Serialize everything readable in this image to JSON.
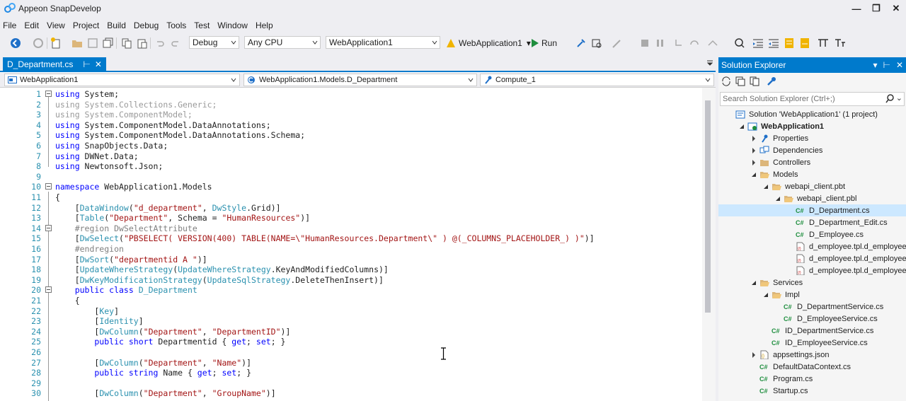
{
  "app": {
    "title": "Appeon SnapDevelop"
  },
  "menu": [
    "File",
    "Edit",
    "View",
    "Project",
    "Build",
    "Debug",
    "Tools",
    "Test",
    "Window",
    "Help"
  ],
  "toolbar": {
    "config": "Debug",
    "platform": "Any CPU",
    "project": "WebApplication1",
    "startup": "WebApplication1",
    "run": "Run"
  },
  "editor": {
    "tab": "D_Department.cs",
    "nav": {
      "project": "WebApplication1",
      "class": "WebApplication1.Models.D_Department",
      "member": "Compute_1"
    },
    "lines": [
      {
        "n": "1",
        "fold": true,
        "segs": [
          {
            "c": "k",
            "t": "using"
          },
          {
            "c": "",
            "t": " System;"
          }
        ]
      },
      {
        "n": "2",
        "segs": [
          {
            "c": "g",
            "t": "using System.Collections.Generic;"
          }
        ]
      },
      {
        "n": "3",
        "segs": [
          {
            "c": "g",
            "t": "using System.ComponentModel;"
          }
        ]
      },
      {
        "n": "4",
        "segs": [
          {
            "c": "k",
            "t": "using"
          },
          {
            "c": "",
            "t": " System.ComponentModel.DataAnnotations;"
          }
        ]
      },
      {
        "n": "5",
        "segs": [
          {
            "c": "k",
            "t": "using"
          },
          {
            "c": "",
            "t": " System.ComponentModel.DataAnnotations.Schema;"
          }
        ]
      },
      {
        "n": "6",
        "segs": [
          {
            "c": "k",
            "t": "using"
          },
          {
            "c": "",
            "t": " SnapObjects.Data;"
          }
        ]
      },
      {
        "n": "7",
        "segs": [
          {
            "c": "k",
            "t": "using"
          },
          {
            "c": "",
            "t": " DWNet.Data;"
          }
        ]
      },
      {
        "n": "8",
        "segs": [
          {
            "c": "k",
            "t": "using"
          },
          {
            "c": "",
            "t": " Newtonsoft.Json;"
          }
        ]
      },
      {
        "n": "9",
        "segs": []
      },
      {
        "n": "10",
        "fold": true,
        "segs": [
          {
            "c": "k",
            "t": "namespace"
          },
          {
            "c": "",
            "t": " WebApplication1.Models"
          }
        ]
      },
      {
        "n": "11",
        "segs": [
          {
            "c": "",
            "t": "{"
          }
        ]
      },
      {
        "n": "12",
        "segs": [
          {
            "c": "",
            "t": "    ["
          },
          {
            "c": "t",
            "t": "DataWindow"
          },
          {
            "c": "",
            "t": "("
          },
          {
            "c": "s",
            "t": "\"d_department\""
          },
          {
            "c": "",
            "t": ", "
          },
          {
            "c": "t",
            "t": "DwStyle"
          },
          {
            "c": "",
            "t": ".Grid)]"
          }
        ]
      },
      {
        "n": "13",
        "segs": [
          {
            "c": "",
            "t": "    ["
          },
          {
            "c": "t",
            "t": "Table"
          },
          {
            "c": "",
            "t": "("
          },
          {
            "c": "s",
            "t": "\"Department\""
          },
          {
            "c": "",
            "t": ", Schema = "
          },
          {
            "c": "s",
            "t": "\"HumanResources\""
          },
          {
            "c": "",
            "t": ")]"
          }
        ]
      },
      {
        "n": "14",
        "fold": true,
        "segs": [
          {
            "c": "r",
            "t": "    #region DwSelectAttribute"
          }
        ]
      },
      {
        "n": "15",
        "segs": [
          {
            "c": "",
            "t": "    ["
          },
          {
            "c": "t",
            "t": "DwSelect"
          },
          {
            "c": "",
            "t": "("
          },
          {
            "c": "s",
            "t": "\"PBSELECT( VERSION(400) TABLE(NAME=\\\"HumanResources.Department\\\" ) @(_COLUMNS_PLACEHOLDER_) )\""
          },
          {
            "c": "",
            "t": ")]"
          }
        ]
      },
      {
        "n": "16",
        "segs": [
          {
            "c": "r",
            "t": "    #endregion"
          }
        ]
      },
      {
        "n": "17",
        "segs": [
          {
            "c": "",
            "t": "    ["
          },
          {
            "c": "t",
            "t": "DwSort"
          },
          {
            "c": "",
            "t": "("
          },
          {
            "c": "s",
            "t": "\"departmentid A \""
          },
          {
            "c": "",
            "t": ")]"
          }
        ]
      },
      {
        "n": "18",
        "segs": [
          {
            "c": "",
            "t": "    ["
          },
          {
            "c": "t",
            "t": "UpdateWhereStrategy"
          },
          {
            "c": "",
            "t": "("
          },
          {
            "c": "t",
            "t": "UpdateWhereStrategy"
          },
          {
            "c": "",
            "t": ".KeyAndModifiedColumns)]"
          }
        ]
      },
      {
        "n": "19",
        "segs": [
          {
            "c": "",
            "t": "    ["
          },
          {
            "c": "t",
            "t": "DwKeyModificationStrategy"
          },
          {
            "c": "",
            "t": "("
          },
          {
            "c": "t",
            "t": "UpdateSqlStrategy"
          },
          {
            "c": "",
            "t": ".DeleteThenInsert)]"
          }
        ]
      },
      {
        "n": "20",
        "fold": true,
        "segs": [
          {
            "c": "k",
            "t": "    public class"
          },
          {
            "c": "",
            "t": " "
          },
          {
            "c": "t",
            "t": "D_Department"
          }
        ]
      },
      {
        "n": "21",
        "segs": [
          {
            "c": "",
            "t": "    {"
          }
        ]
      },
      {
        "n": "22",
        "segs": [
          {
            "c": "",
            "t": "        ["
          },
          {
            "c": "t",
            "t": "Key"
          },
          {
            "c": "",
            "t": "]"
          }
        ]
      },
      {
        "n": "23",
        "segs": [
          {
            "c": "",
            "t": "        ["
          },
          {
            "c": "t",
            "t": "Identity"
          },
          {
            "c": "",
            "t": "]"
          }
        ]
      },
      {
        "n": "24",
        "segs": [
          {
            "c": "",
            "t": "        ["
          },
          {
            "c": "t",
            "t": "DwColumn"
          },
          {
            "c": "",
            "t": "("
          },
          {
            "c": "s",
            "t": "\"Department\""
          },
          {
            "c": "",
            "t": ", "
          },
          {
            "c": "s",
            "t": "\"DepartmentID\""
          },
          {
            "c": "",
            "t": ")]"
          }
        ]
      },
      {
        "n": "25",
        "segs": [
          {
            "c": "k",
            "t": "        public short"
          },
          {
            "c": "",
            "t": " Departmentid { "
          },
          {
            "c": "k",
            "t": "get"
          },
          {
            "c": "",
            "t": "; "
          },
          {
            "c": "k",
            "t": "set"
          },
          {
            "c": "",
            "t": "; }"
          }
        ]
      },
      {
        "n": "26",
        "segs": []
      },
      {
        "n": "27",
        "segs": [
          {
            "c": "",
            "t": "        ["
          },
          {
            "c": "t",
            "t": "DwColumn"
          },
          {
            "c": "",
            "t": "("
          },
          {
            "c": "s",
            "t": "\"Department\""
          },
          {
            "c": "",
            "t": ", "
          },
          {
            "c": "s",
            "t": "\"Name\""
          },
          {
            "c": "",
            "t": ")]"
          }
        ]
      },
      {
        "n": "28",
        "segs": [
          {
            "c": "k",
            "t": "        public string"
          },
          {
            "c": "",
            "t": " Name { "
          },
          {
            "c": "k",
            "t": "get"
          },
          {
            "c": "",
            "t": "; "
          },
          {
            "c": "k",
            "t": "set"
          },
          {
            "c": "",
            "t": "; }"
          }
        ]
      },
      {
        "n": "29",
        "segs": []
      },
      {
        "n": "30",
        "segs": [
          {
            "c": "",
            "t": "        ["
          },
          {
            "c": "t",
            "t": "DwColumn"
          },
          {
            "c": "",
            "t": "("
          },
          {
            "c": "s",
            "t": "\"Department\""
          },
          {
            "c": "",
            "t": ", "
          },
          {
            "c": "s",
            "t": "\"GroupName\""
          },
          {
            "c": "",
            "t": ")]"
          }
        ]
      }
    ]
  },
  "solution_explorer": {
    "title": "Solution Explorer",
    "search_placeholder": "Search Solution Explorer (Ctrl+;)",
    "nodes": [
      {
        "label": "Solution 'WebApplication1' (1 project)",
        "level": 0,
        "icon": "solution-icon",
        "tw": "none"
      },
      {
        "label": "WebApplication1",
        "level": 1,
        "icon": "project-icon",
        "tw": "open",
        "bold": true
      },
      {
        "label": "Properties",
        "level": 2,
        "icon": "wrench-icon",
        "tw": "closed"
      },
      {
        "label": "Dependencies",
        "level": 2,
        "icon": "dependencies-icon",
        "tw": "closed"
      },
      {
        "label": "Controllers",
        "level": 2,
        "icon": "folder-icon",
        "tw": "closed"
      },
      {
        "label": "Models",
        "level": 2,
        "icon": "folder-open-icon",
        "tw": "open"
      },
      {
        "label": "webapi_client.pbt",
        "level": 3,
        "icon": "folder-open-icon",
        "tw": "open"
      },
      {
        "label": "webapi_client.pbl",
        "level": 4,
        "icon": "folder-open-icon",
        "tw": "open"
      },
      {
        "label": "D_Department.cs",
        "level": 5,
        "icon": "csharp-file-icon",
        "tw": "none",
        "selected": true
      },
      {
        "label": "D_Department_Edit.cs",
        "level": 5,
        "icon": "csharp-file-icon",
        "tw": "none"
      },
      {
        "label": "D_Employee.cs",
        "level": 5,
        "icon": "csharp-file-icon",
        "tw": "none"
      },
      {
        "label": "d_employee.tpl.d_employee_a",
        "level": 5,
        "icon": "template-file-icon",
        "tw": "none"
      },
      {
        "label": "d_employee.tpl.d_employee_l",
        "level": 5,
        "icon": "template-file-icon",
        "tw": "none"
      },
      {
        "label": "d_employee.tpl.d_employee_l",
        "level": 5,
        "icon": "template-file-icon",
        "tw": "none"
      },
      {
        "label": "Services",
        "level": 2,
        "icon": "folder-open-icon",
        "tw": "open"
      },
      {
        "label": "Impl",
        "level": 3,
        "icon": "folder-open-icon",
        "tw": "open"
      },
      {
        "label": "D_DepartmentService.cs",
        "level": 4,
        "icon": "csharp-file-icon",
        "tw": "none"
      },
      {
        "label": "D_EmployeeService.cs",
        "level": 4,
        "icon": "csharp-file-icon",
        "tw": "none"
      },
      {
        "label": "ID_DepartmentService.cs",
        "level": 3,
        "icon": "csharp-file-icon",
        "tw": "none"
      },
      {
        "label": "ID_EmployeeService.cs",
        "level": 3,
        "icon": "csharp-file-icon",
        "tw": "none"
      },
      {
        "label": "appsettings.json",
        "level": 2,
        "icon": "json-file-icon",
        "tw": "closed"
      },
      {
        "label": "DefaultDataContext.cs",
        "level": 2,
        "icon": "csharp-file-icon",
        "tw": "none"
      },
      {
        "label": "Program.cs",
        "level": 2,
        "icon": "csharp-file-icon",
        "tw": "none"
      },
      {
        "label": "Startup.cs",
        "level": 2,
        "icon": "csharp-file-icon",
        "tw": "none"
      }
    ]
  },
  "colors": {
    "accent": "#007acc",
    "keyword": "#0000ff",
    "type": "#2b91af",
    "string": "#a31515",
    "selection": "#cce8ff"
  }
}
